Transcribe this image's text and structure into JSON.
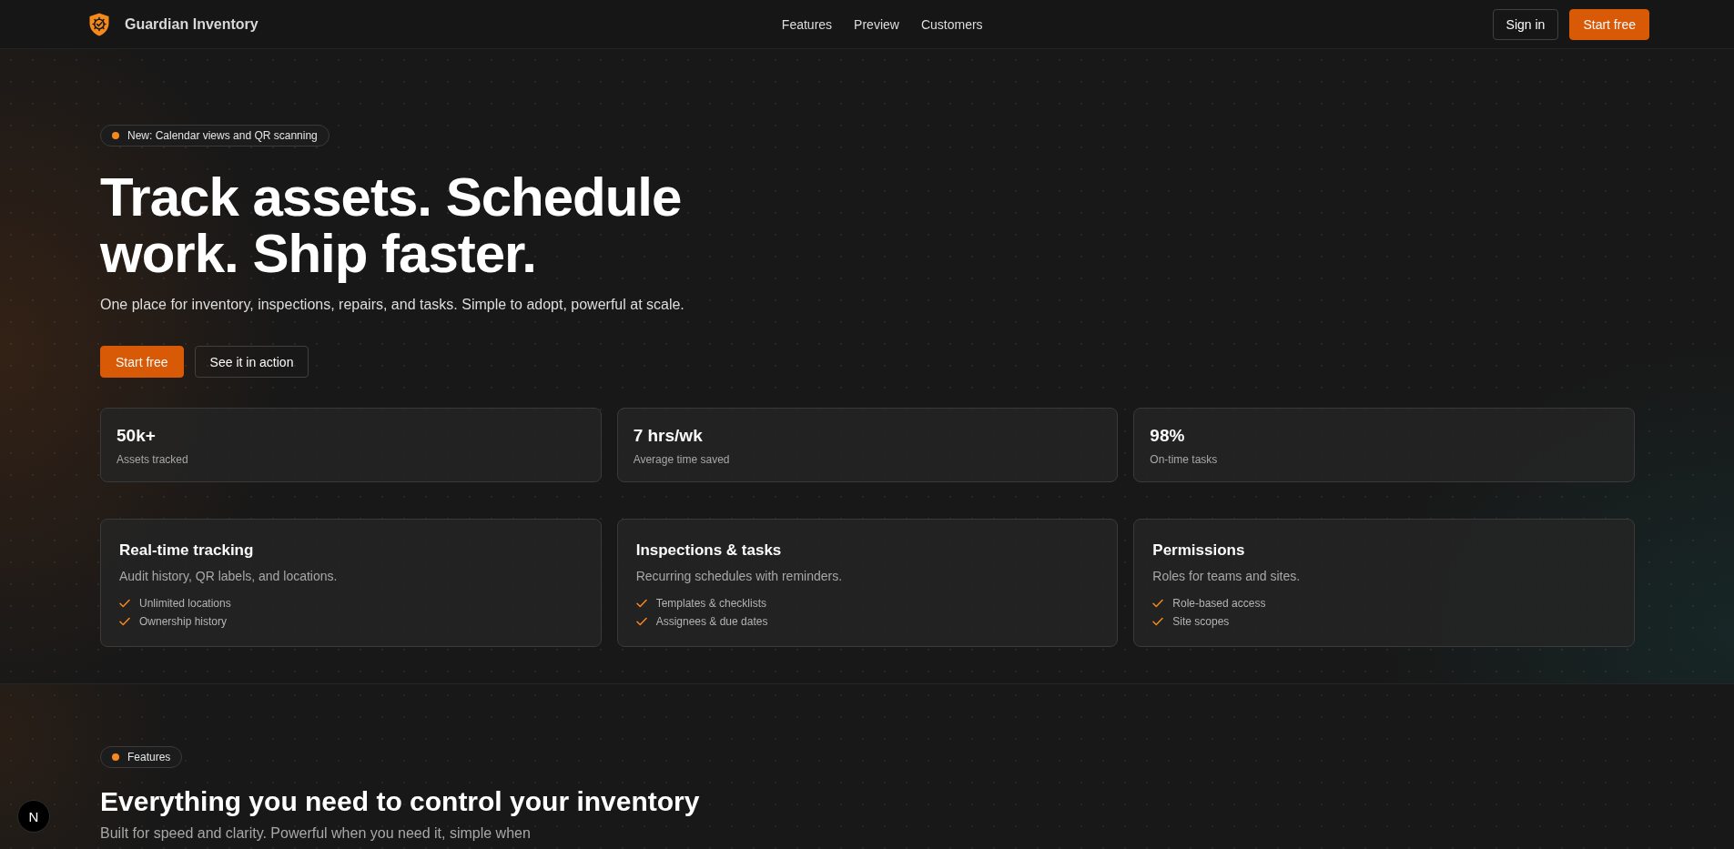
{
  "header": {
    "brand": "Guardian Inventory",
    "nav": [
      {
        "label": "Features"
      },
      {
        "label": "Preview"
      },
      {
        "label": "Customers"
      }
    ],
    "actions": [
      {
        "label": "Sign in",
        "kind": "outline"
      },
      {
        "label": "Start free",
        "kind": "primary"
      }
    ]
  },
  "hero": {
    "badge": "New: Calendar views and QR scanning",
    "title": "Track assets. Schedule work. Ship faster.",
    "subtitle": "One place for inventory, inspections, repairs, and tasks. Simple to adopt, powerful at scale.",
    "buttons": [
      {
        "label": "Start free",
        "kind": "primary"
      },
      {
        "label": "See it in action",
        "kind": "outline"
      }
    ],
    "stats": [
      {
        "value": "50k+",
        "label": "Assets tracked"
      },
      {
        "value": "7 hrs/wk",
        "label": "Average time saved"
      },
      {
        "value": "98%",
        "label": "On-time tasks"
      }
    ],
    "highlights": [
      {
        "title": "Real-time tracking",
        "description": "Audit history, QR labels, and locations.",
        "points": [
          "Unlimited locations",
          "Ownership history"
        ]
      },
      {
        "title": "Inspections & tasks",
        "description": "Recurring schedules with reminders.",
        "points": [
          "Templates & checklists",
          "Assignees & due dates"
        ]
      },
      {
        "title": "Permissions",
        "description": "Roles for teams and sites.",
        "points": [
          "Role-based access",
          "Site scopes"
        ]
      }
    ]
  },
  "features": {
    "badge": "Features",
    "title": "Everything you need to control your inventory",
    "subtitle": "Built for speed and clarity. Powerful when you need it, simple when"
  },
  "floating_button": {
    "label": "N"
  }
}
